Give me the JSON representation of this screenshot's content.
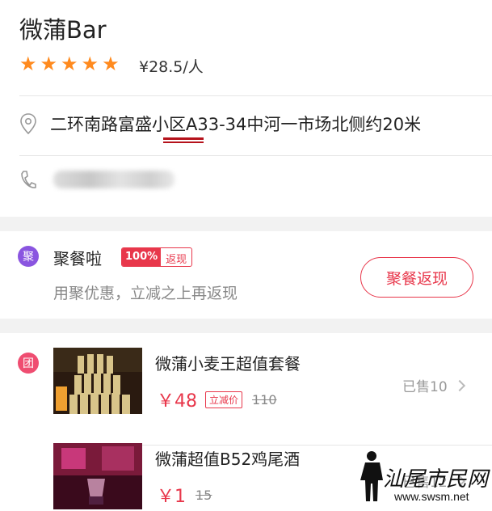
{
  "shop": {
    "name": "微蒲Bar",
    "rating_stars": 5,
    "price_per_person": "¥28.5/人",
    "address": "二环南路富盛小区A33-34中河一市场北侧约20米",
    "phone": ""
  },
  "deal": {
    "icon_label": "聚",
    "title": "聚餐啦",
    "badge_percent": "100%",
    "badge_text": "返现",
    "subtitle": "用聚优惠，立减之上再返现",
    "button_label": "聚餐返现"
  },
  "groups": {
    "icon_label": "团",
    "items": [
      {
        "title": "微蒲小麦王超值套餐",
        "price": "￥48",
        "tag": "立减价",
        "old_price": "110",
        "sold": "已售10"
      },
      {
        "title": "微蒲超值B52鸡尾酒",
        "price": "￥1",
        "tag": "",
        "old_price": "15",
        "sold": "已售12"
      }
    ]
  },
  "watermark": {
    "text": "汕尾市民网",
    "url": "www.swsm.net"
  },
  "colors": {
    "accent": "#e8374b",
    "star": "#ff8a1e",
    "deal_icon": "#8a55e0",
    "group_icon": "#ef4d71"
  }
}
